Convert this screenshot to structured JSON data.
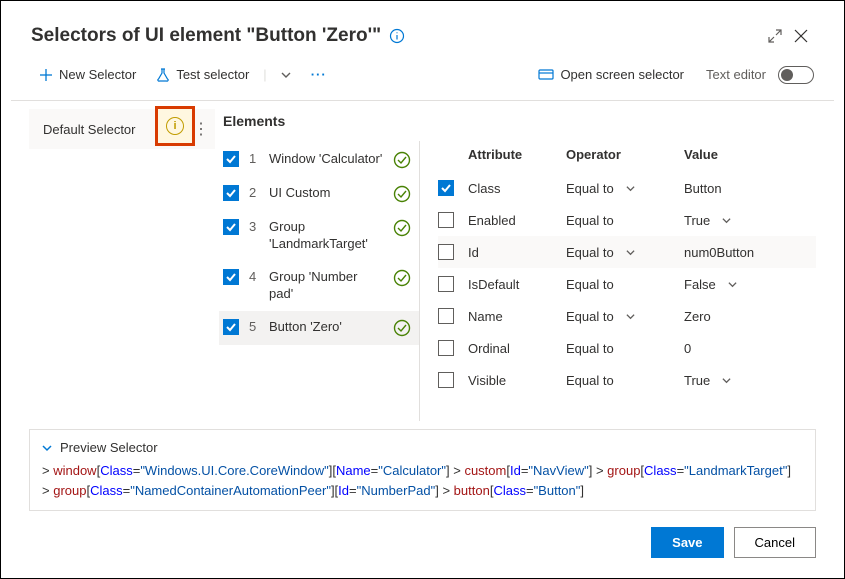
{
  "header": {
    "title": "Selectors of UI element \"Button 'Zero'\""
  },
  "toolbar": {
    "new_selector": "New Selector",
    "test_selector": "Test selector",
    "open_screen": "Open screen selector",
    "text_editor": "Text editor"
  },
  "sidebar": {
    "label": "Default Selector"
  },
  "elements": {
    "title": "Elements",
    "items": [
      {
        "n": "1",
        "name": "Window 'Calculator'",
        "checked": true
      },
      {
        "n": "2",
        "name": "UI Custom",
        "checked": true
      },
      {
        "n": "3",
        "name": "Group 'LandmarkTarget'",
        "checked": true
      },
      {
        "n": "4",
        "name": "Group 'Number pad'",
        "checked": true
      },
      {
        "n": "5",
        "name": "Button 'Zero'",
        "checked": true,
        "selected": true
      }
    ]
  },
  "attrs": {
    "head": {
      "c1": "Attribute",
      "c2": "Operator",
      "c3": "Value"
    },
    "rows": [
      {
        "checked": true,
        "attr": "Class",
        "op": "Equal to",
        "op_chev": true,
        "val": "Button",
        "val_chev": false
      },
      {
        "checked": false,
        "attr": "Enabled",
        "op": "Equal to",
        "op_chev": false,
        "val": "True",
        "val_chev": true
      },
      {
        "checked": false,
        "attr": "Id",
        "op": "Equal to",
        "op_chev": true,
        "val": "num0Button",
        "val_chev": false,
        "hl": true
      },
      {
        "checked": false,
        "attr": "IsDefault",
        "op": "Equal to",
        "op_chev": false,
        "val": "False",
        "val_chev": true
      },
      {
        "checked": false,
        "attr": "Name",
        "op": "Equal to",
        "op_chev": true,
        "val": "Zero",
        "val_chev": false
      },
      {
        "checked": false,
        "attr": "Ordinal",
        "op": "Equal to",
        "op_chev": false,
        "val": "0",
        "val_chev": false
      },
      {
        "checked": false,
        "attr": "Visible",
        "op": "Equal to",
        "op_chev": false,
        "val": "True",
        "val_chev": true
      }
    ]
  },
  "preview": {
    "title": "Preview Selector",
    "tokens": [
      {
        "t": "gt",
        "v": "> "
      },
      {
        "t": "kw",
        "v": "window"
      },
      {
        "t": "pln",
        "v": "["
      },
      {
        "t": "attr",
        "v": "Class"
      },
      {
        "t": "pln",
        "v": "="
      },
      {
        "t": "str",
        "v": "\"Windows.UI.Core.CoreWindow\""
      },
      {
        "t": "pln",
        "v": "]["
      },
      {
        "t": "attr",
        "v": "Name"
      },
      {
        "t": "pln",
        "v": "="
      },
      {
        "t": "str",
        "v": "\"Calculator\""
      },
      {
        "t": "pln",
        "v": "] "
      },
      {
        "t": "gt",
        "v": "> "
      },
      {
        "t": "kw",
        "v": "custom"
      },
      {
        "t": "pln",
        "v": "["
      },
      {
        "t": "attr",
        "v": "Id"
      },
      {
        "t": "pln",
        "v": "="
      },
      {
        "t": "str",
        "v": "\"NavView\""
      },
      {
        "t": "pln",
        "v": "] "
      },
      {
        "t": "gt",
        "v": "> "
      },
      {
        "t": "kw",
        "v": "group"
      },
      {
        "t": "pln",
        "v": "["
      },
      {
        "t": "attr",
        "v": "Class"
      },
      {
        "t": "pln",
        "v": "="
      },
      {
        "t": "str",
        "v": "\"LandmarkTarget\""
      },
      {
        "t": "pln",
        "v": "] "
      },
      {
        "t": "br",
        "v": ""
      },
      {
        "t": "gt",
        "v": "> "
      },
      {
        "t": "kw",
        "v": "group"
      },
      {
        "t": "pln",
        "v": "["
      },
      {
        "t": "attr",
        "v": "Class"
      },
      {
        "t": "pln",
        "v": "="
      },
      {
        "t": "str",
        "v": "\"NamedContainerAutomationPeer\""
      },
      {
        "t": "pln",
        "v": "]["
      },
      {
        "t": "attr",
        "v": "Id"
      },
      {
        "t": "pln",
        "v": "="
      },
      {
        "t": "str",
        "v": "\"NumberPad\""
      },
      {
        "t": "pln",
        "v": "] "
      },
      {
        "t": "gt",
        "v": "> "
      },
      {
        "t": "kw",
        "v": "button"
      },
      {
        "t": "pln",
        "v": "["
      },
      {
        "t": "attr",
        "v": "Class"
      },
      {
        "t": "pln",
        "v": "="
      },
      {
        "t": "str",
        "v": "\"Button\""
      },
      {
        "t": "pln",
        "v": "]"
      }
    ]
  },
  "footer": {
    "save": "Save",
    "cancel": "Cancel"
  }
}
